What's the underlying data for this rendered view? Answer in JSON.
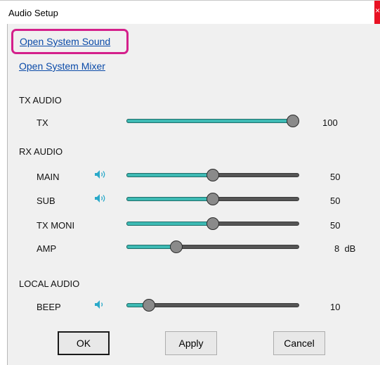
{
  "window": {
    "title": "Audio Setup",
    "close_glyph": "×"
  },
  "links": {
    "open_system_sound": "Open System Sound",
    "open_system_mixer": "Open System Mixer"
  },
  "tx_audio": {
    "section_label": "TX AUDIO",
    "rows": [
      {
        "label": "TX",
        "value": "100",
        "level": 1.0,
        "has_speaker": false
      }
    ]
  },
  "rx_audio": {
    "section_label": "RX AUDIO",
    "rows": [
      {
        "label": "MAIN",
        "value": "50",
        "level": 0.5,
        "has_speaker": true,
        "speaker_icon": "speaker-icon"
      },
      {
        "label": "SUB",
        "value": "50",
        "level": 0.5,
        "has_speaker": true,
        "speaker_icon": "speaker-icon"
      },
      {
        "label": "TX MONI",
        "value": "50",
        "level": 0.5,
        "has_speaker": false
      },
      {
        "label": "AMP",
        "value": "8  dB",
        "level": 0.27,
        "has_speaker": false
      }
    ]
  },
  "local_audio": {
    "section_label": "LOCAL AUDIO",
    "rows": [
      {
        "label": "BEEP",
        "value": "10",
        "level": 0.1,
        "has_speaker": true,
        "speaker_icon": "speaker-icon"
      }
    ]
  },
  "buttons": {
    "ok": "OK",
    "apply": "Apply",
    "cancel": "Cancel"
  },
  "colors": {
    "accent": "#3dbab4",
    "highlight": "#d4208b",
    "link": "#0a4aa8",
    "close": "#e81123"
  }
}
